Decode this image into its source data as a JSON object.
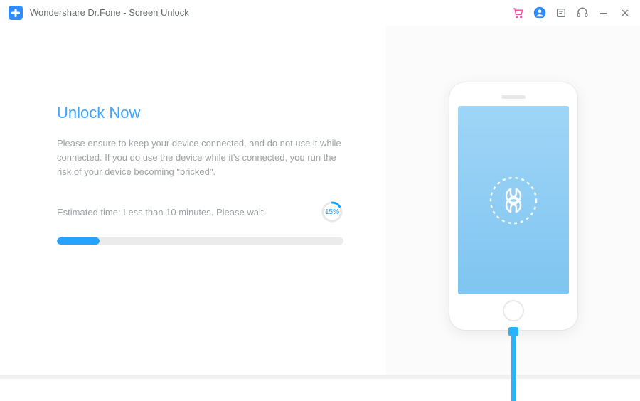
{
  "app": {
    "title": "Wondershare Dr.Fone - Screen Unlock"
  },
  "main": {
    "heading": "Unlock Now",
    "description": "Please ensure to keep your device connected, and do not use it while connected. If you do use the device while it's connected, you run the risk of your device becoming \"bricked\".",
    "estimated_time": "Estimated time: Less than 10 minutes. Please wait.",
    "progress_percent": 15,
    "progress_label": "15%"
  },
  "colors": {
    "accent": "#26a3ff",
    "heading": "#3ea6ff",
    "muted": "#9ea2a7"
  }
}
